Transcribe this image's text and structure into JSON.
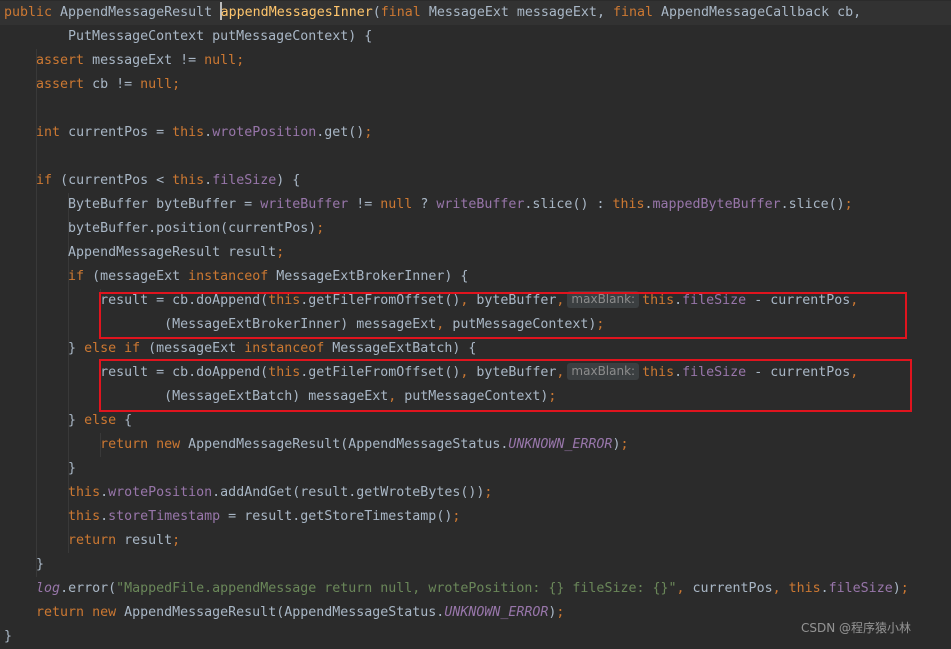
{
  "editor": {
    "theme": "darcula",
    "colors": {
      "background": "#2b2b2b",
      "keyword": "#cc7832",
      "field": "#9876aa",
      "method_declaration": "#ffc66d",
      "string": "#6a8759",
      "plain": "#a9b7c6",
      "highlight_box": "#e0141e"
    },
    "lines": [
      {
        "tokens": [
          {
            "t": "public ",
            "c": "kw"
          },
          {
            "t": "AppendMessageResult "
          },
          {
            "caret": true
          },
          {
            "t": "appendMessagesInner",
            "c": "fn"
          },
          {
            "t": "("
          },
          {
            "t": "final ",
            "c": "kw"
          },
          {
            "t": "MessageExt messageExt, "
          },
          {
            "t": "final ",
            "c": "kw"
          },
          {
            "t": "AppendMessageCallback "
          },
          {
            "t": "cb,"
          }
        ]
      },
      {
        "tokens": [
          {
            "t": "        PutMessageContext putMessageContext) {"
          }
        ]
      },
      {
        "tokens": [
          {
            "t": "    "
          },
          {
            "t": "assert ",
            "c": "kw"
          },
          {
            "t": "messageExt != "
          },
          {
            "t": "null",
            "c": "kw"
          },
          {
            "t": ";",
            "c": "kw"
          }
        ]
      },
      {
        "tokens": [
          {
            "t": "    "
          },
          {
            "t": "assert ",
            "c": "kw"
          },
          {
            "t": "cb != "
          },
          {
            "t": "null",
            "c": "kw"
          },
          {
            "t": ";",
            "c": "kw"
          }
        ]
      },
      {
        "tokens": []
      },
      {
        "tokens": [
          {
            "t": "    "
          },
          {
            "t": "int ",
            "c": "kw"
          },
          {
            "t": "currentPos = "
          },
          {
            "t": "this",
            "c": "kw"
          },
          {
            "t": "."
          },
          {
            "t": "wrotePosition",
            "c": "fld"
          },
          {
            "t": ".get()"
          },
          {
            "t": ";",
            "c": "kw"
          }
        ]
      },
      {
        "tokens": []
      },
      {
        "tokens": [
          {
            "t": "    "
          },
          {
            "t": "if ",
            "c": "kw"
          },
          {
            "t": "(currentPos < "
          },
          {
            "t": "this",
            "c": "kw"
          },
          {
            "t": "."
          },
          {
            "t": "fileSize",
            "c": "fld"
          },
          {
            "t": ") {"
          }
        ]
      },
      {
        "tokens": [
          {
            "t": "        ByteBuffer byteBuffer = "
          },
          {
            "t": "writeBuffer",
            "c": "fld"
          },
          {
            "t": " != "
          },
          {
            "t": "null",
            "c": "kw"
          },
          {
            "t": " ? "
          },
          {
            "t": "writeBuffer",
            "c": "fld"
          },
          {
            "t": ".slice() : "
          },
          {
            "t": "this",
            "c": "kw"
          },
          {
            "t": "."
          },
          {
            "t": "mappedByteBuffer",
            "c": "fld"
          },
          {
            "t": ".slice()"
          },
          {
            "t": ";",
            "c": "kw"
          }
        ]
      },
      {
        "tokens": [
          {
            "t": "        byteBuffer.position(currentPos)"
          },
          {
            "t": ";",
            "c": "kw"
          }
        ]
      },
      {
        "tokens": [
          {
            "t": "        AppendMessageResult result"
          },
          {
            "t": ";",
            "c": "kw"
          }
        ]
      },
      {
        "tokens": [
          {
            "t": "        "
          },
          {
            "t": "if ",
            "c": "kw"
          },
          {
            "t": "(messageExt "
          },
          {
            "t": "instanceof ",
            "c": "kw"
          },
          {
            "t": "MessageExtBrokerInner) {"
          }
        ]
      },
      {
        "tokens": [
          {
            "t": "            result = cb.doAppend("
          },
          {
            "t": "this",
            "c": "kw"
          },
          {
            "t": ".getFileFromOffset()"
          },
          {
            "t": ",",
            "c": "kw"
          },
          {
            "t": " byteBuffer"
          },
          {
            "t": ",",
            "c": "kw"
          },
          {
            "hint": "maxBlank:"
          },
          {
            "t": "this",
            "c": "kw"
          },
          {
            "t": "."
          },
          {
            "t": "fileSize",
            "c": "fld"
          },
          {
            "t": " - currentPos"
          },
          {
            "t": ",",
            "c": "kw"
          }
        ]
      },
      {
        "tokens": [
          {
            "t": "                    (MessageExtBrokerInner) messageExt"
          },
          {
            "t": ",",
            "c": "kw"
          },
          {
            "t": " putMessageContext)"
          },
          {
            "t": ";",
            "c": "kw"
          }
        ]
      },
      {
        "tokens": [
          {
            "t": "        } "
          },
          {
            "t": "else if ",
            "c": "kw"
          },
          {
            "t": "(messageExt "
          },
          {
            "t": "instanceof ",
            "c": "kw"
          },
          {
            "t": "MessageExtBatch) {"
          }
        ]
      },
      {
        "tokens": [
          {
            "t": "            result = cb.doAppend("
          },
          {
            "t": "this",
            "c": "kw"
          },
          {
            "t": ".getFileFromOffset()"
          },
          {
            "t": ",",
            "c": "kw"
          },
          {
            "t": " byteBuffer"
          },
          {
            "t": ",",
            "c": "kw"
          },
          {
            "hint": "maxBlank:"
          },
          {
            "t": "this",
            "c": "kw"
          },
          {
            "t": "."
          },
          {
            "t": "fileSize",
            "c": "fld"
          },
          {
            "t": " - currentPos"
          },
          {
            "t": ",",
            "c": "kw"
          }
        ]
      },
      {
        "tokens": [
          {
            "t": "                    (MessageExtBatch) messageExt"
          },
          {
            "t": ",",
            "c": "kw"
          },
          {
            "t": " putMessageContext)"
          },
          {
            "t": ";",
            "c": "kw"
          }
        ]
      },
      {
        "tokens": [
          {
            "t": "        } "
          },
          {
            "t": "else ",
            "c": "kw"
          },
          {
            "t": "{"
          }
        ]
      },
      {
        "tokens": [
          {
            "t": "            "
          },
          {
            "t": "return new ",
            "c": "kw"
          },
          {
            "t": "AppendMessageResult(AppendMessageStatus."
          },
          {
            "t": "UNKNOWN_ERROR",
            "c": "cst"
          },
          {
            "t": ")"
          },
          {
            "t": ";",
            "c": "kw"
          }
        ]
      },
      {
        "tokens": [
          {
            "t": "        }"
          }
        ]
      },
      {
        "tokens": [
          {
            "t": "        "
          },
          {
            "t": "this",
            "c": "kw"
          },
          {
            "t": "."
          },
          {
            "t": "wrotePosition",
            "c": "fld"
          },
          {
            "t": ".addAndGet(result.getWroteBytes())"
          },
          {
            "t": ";",
            "c": "kw"
          }
        ]
      },
      {
        "tokens": [
          {
            "t": "        "
          },
          {
            "t": "this",
            "c": "kw"
          },
          {
            "t": "."
          },
          {
            "t": "storeTimestamp",
            "c": "fld"
          },
          {
            "t": " = result.getStoreTimestamp()"
          },
          {
            "t": ";",
            "c": "kw"
          }
        ]
      },
      {
        "tokens": [
          {
            "t": "        "
          },
          {
            "t": "return ",
            "c": "kw"
          },
          {
            "t": "result"
          },
          {
            "t": ";",
            "c": "kw"
          }
        ]
      },
      {
        "tokens": [
          {
            "t": "    }"
          }
        ]
      },
      {
        "tokens": [
          {
            "t": "    "
          },
          {
            "t": "log",
            "c": "cst"
          },
          {
            "t": ".error("
          },
          {
            "t": "\"MappedFile.appendMessage return null, wrotePosition: {} fileSize: {}\"",
            "c": "str"
          },
          {
            "t": ",",
            "c": "kw"
          },
          {
            "t": " currentPos"
          },
          {
            "t": ",",
            "c": "kw"
          },
          {
            "t": " "
          },
          {
            "t": "this",
            "c": "kw"
          },
          {
            "t": "."
          },
          {
            "t": "fileSize",
            "c": "fld"
          },
          {
            "t": ")"
          },
          {
            "t": ";",
            "c": "kw"
          }
        ]
      },
      {
        "tokens": [
          {
            "t": "    "
          },
          {
            "t": "return new ",
            "c": "kw"
          },
          {
            "t": "AppendMessageResult(AppendMessageStatus."
          },
          {
            "t": "UNKNOWN_ERROR",
            "c": "cst"
          },
          {
            "t": ")"
          },
          {
            "t": ";",
            "c": "kw"
          }
        ]
      },
      {
        "tokens": [
          {
            "t": "}"
          }
        ]
      }
    ],
    "highlight_boxes": [
      {
        "label": "doAppend-brokerinner-call"
      },
      {
        "label": "doAppend-batch-call"
      }
    ]
  },
  "watermark": {
    "text": "CSDN @程序猿小林"
  }
}
